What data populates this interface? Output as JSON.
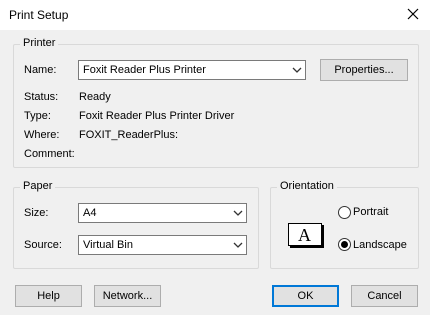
{
  "window": {
    "title": "Print Setup"
  },
  "printer": {
    "group_label": "Printer",
    "name_label": "Name:",
    "name_value": "Foxit Reader Plus Printer",
    "properties_label": "Properties...",
    "status_label": "Status:",
    "status_value": "Ready",
    "type_label": "Type:",
    "type_value": "Foxit Reader Plus Printer Driver",
    "where_label": "Where:",
    "where_value": "FOXIT_ReaderPlus:",
    "comment_label": "Comment:",
    "comment_value": ""
  },
  "paper": {
    "group_label": "Paper",
    "size_label": "Size:",
    "size_value": "A4",
    "source_label": "Source:",
    "source_value": "Virtual Bin"
  },
  "orientation": {
    "group_label": "Orientation",
    "portrait_label": "Portrait",
    "landscape_label": "Landscape",
    "selected": "Landscape",
    "sample_glyph": "A"
  },
  "footer": {
    "help_label": "Help",
    "network_label": "Network...",
    "ok_label": "OK",
    "cancel_label": "Cancel"
  }
}
